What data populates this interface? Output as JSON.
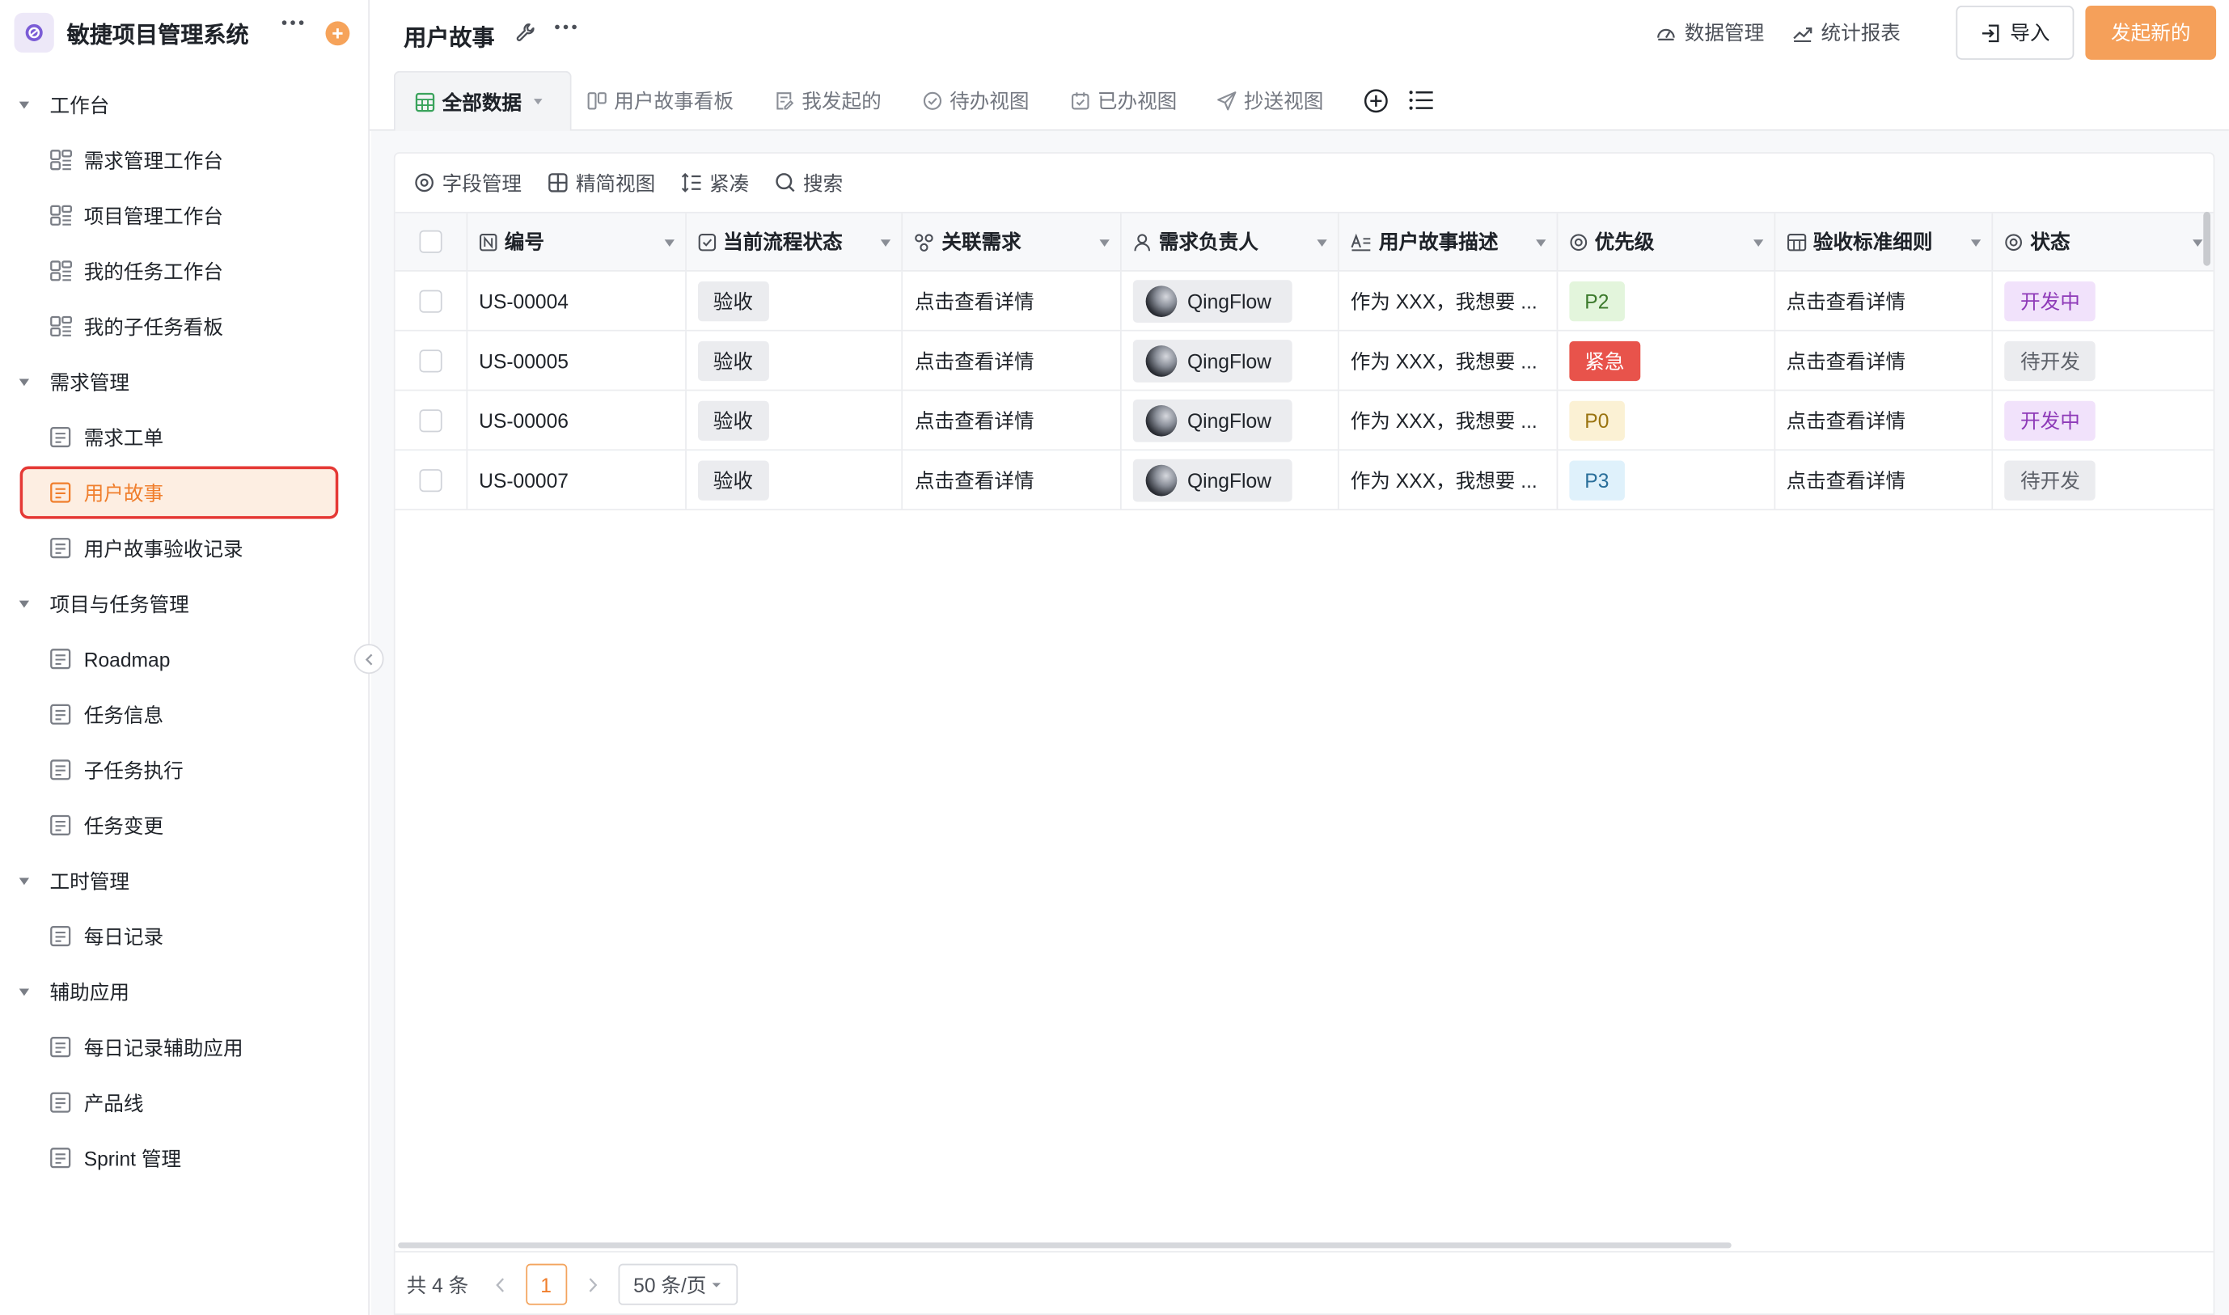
{
  "app": {
    "title": "敏捷项目管理系统"
  },
  "sidebar": {
    "groups": [
      {
        "label": "工作台",
        "items": [
          {
            "label": "需求管理工作台",
            "icon": "board-icon"
          },
          {
            "label": "项目管理工作台",
            "icon": "board-icon"
          },
          {
            "label": "我的任务工作台",
            "icon": "board-icon"
          },
          {
            "label": "我的子任务看板",
            "icon": "board-icon"
          }
        ]
      },
      {
        "label": "需求管理",
        "items": [
          {
            "label": "需求工单",
            "icon": "form-icon"
          },
          {
            "label": "用户故事",
            "icon": "form-icon",
            "active": true
          },
          {
            "label": "用户故事验收记录",
            "icon": "form-icon"
          }
        ]
      },
      {
        "label": "项目与任务管理",
        "items": [
          {
            "label": "Roadmap",
            "icon": "form-icon"
          },
          {
            "label": "任务信息",
            "icon": "form-icon"
          },
          {
            "label": "子任务执行",
            "icon": "form-icon"
          },
          {
            "label": "任务变更",
            "icon": "form-icon"
          }
        ]
      },
      {
        "label": "工时管理",
        "items": [
          {
            "label": "每日记录",
            "icon": "form-icon"
          }
        ]
      },
      {
        "label": "辅助应用",
        "items": [
          {
            "label": "每日记录辅助应用",
            "icon": "form-icon"
          },
          {
            "label": "产品线",
            "icon": "form-icon"
          },
          {
            "label": "Sprint 管理",
            "icon": "form-icon"
          }
        ]
      }
    ]
  },
  "header": {
    "title": "用户故事",
    "data_mgmt": "数据管理",
    "report": "统计报表",
    "import": "导入",
    "new": "发起新的"
  },
  "tabs": [
    {
      "label": "全部数据",
      "icon": "table-icon",
      "active": true
    },
    {
      "label": "用户故事看板",
      "icon": "kanban-icon"
    },
    {
      "label": "我发起的",
      "icon": "edit-doc-icon"
    },
    {
      "label": "待办视图",
      "icon": "check-circle-icon"
    },
    {
      "label": "已办视图",
      "icon": "calendar-check-icon"
    },
    {
      "label": "抄送视图",
      "icon": "send-icon"
    }
  ],
  "toolbar": {
    "fields": "字段管理",
    "compact_view": "精简视图",
    "dense": "紧凑",
    "search": "搜索"
  },
  "table": {
    "columns": [
      "编号",
      "当前流程状态",
      "关联需求",
      "需求负责人",
      "用户故事描述",
      "优先级",
      "验收标准细则",
      "状态"
    ],
    "rows": [
      {
        "id": "US-00004",
        "flow": "验收",
        "req": "点击查看详情",
        "owner": "QingFlow",
        "desc": "作为 XXX，我想要 ...",
        "priority": "P2",
        "criteria": "点击查看详情",
        "status": "开发中"
      },
      {
        "id": "US-00005",
        "flow": "验收",
        "req": "点击查看详情",
        "owner": "QingFlow",
        "desc": "作为 XXX，我想要 ...",
        "priority": "紧急",
        "criteria": "点击查看详情",
        "status": "待开发"
      },
      {
        "id": "US-00006",
        "flow": "验收",
        "req": "点击查看详情",
        "owner": "QingFlow",
        "desc": "作为 XXX，我想要 ...",
        "priority": "P0",
        "criteria": "点击查看详情",
        "status": "开发中"
      },
      {
        "id": "US-00007",
        "flow": "验收",
        "req": "点击查看详情",
        "owner": "QingFlow",
        "desc": "作为 XXX，我想要 ...",
        "priority": "P3",
        "criteria": "点击查看详情",
        "status": "待开发"
      }
    ]
  },
  "footer": {
    "total": "共 4 条",
    "page": "1",
    "page_size": "50 条/页"
  },
  "colors": {
    "accent": "#f5a05a",
    "active_text": "#f07e2c",
    "highlight_border": "#e53935"
  }
}
